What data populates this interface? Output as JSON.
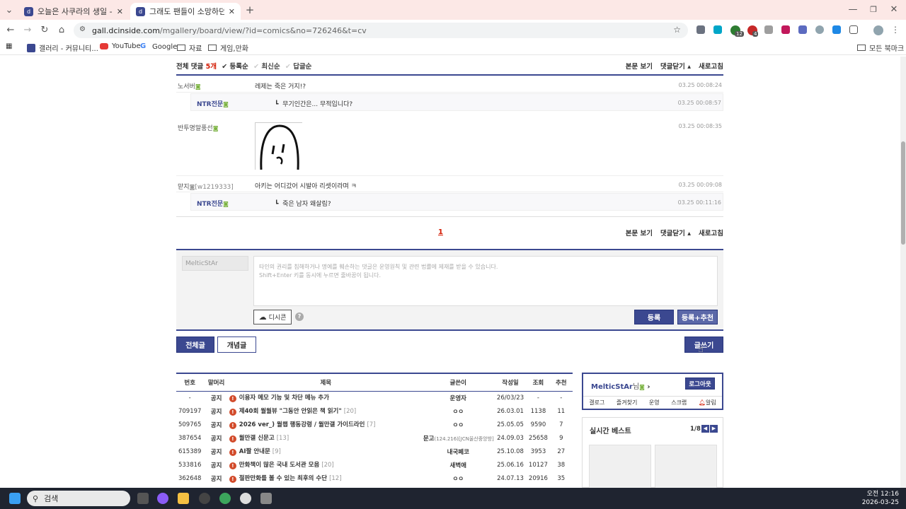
{
  "browser": {
    "tabs": [
      {
        "title": "오늘은 사쿠라의 생일 - 프리피"
      },
      {
        "title": "그래도 팬들이 소망하던거 마지"
      }
    ],
    "url_host": "gall.dcinside.com",
    "url_path": "/mgallery/board/view/?id=comics&no=726246&t=cv",
    "ext_badge1": "12",
    "ext_badge2": "4",
    "bookmarks": [
      "갤러리 - 커뮤니티...",
      "YouTube",
      "Google",
      "자료",
      "게임,만화"
    ],
    "all_bookmarks": "모든 북마크"
  },
  "comments_header": {
    "total_label": "전체 댓글",
    "count": "5개",
    "sort_reg": "등록순",
    "sort_new": "최신순",
    "sort_reply": "답글순",
    "view_post": "본문 보기",
    "close_comments": "댓글닫기",
    "refresh": "새로고침"
  },
  "comments": [
    {
      "nick": "노서버",
      "text": "레제는 죽은 거지!?",
      "date": "03.25 00:08:24"
    },
    {
      "nick": "NTR전문",
      "text": "무기인간은... 무적입니다?",
      "date": "03.25 00:08:57",
      "reply": true
    },
    {
      "nick": "반투명말풍선",
      "text": "",
      "date": "03.25 00:08:35",
      "image": true
    },
    {
      "nick": "맏지",
      "ip": "[w1219333]",
      "text": "아키는 어디갔어 시발아 리셋이라며 ㅋ",
      "date": "03.25 00:09:08"
    },
    {
      "nick": "NTR전문",
      "text": "죽은 남자 왜살림?",
      "date": "03.25 00:11:16",
      "reply": true
    }
  ],
  "pagination": {
    "current": "1"
  },
  "write": {
    "nick_placeholder": "MelticStAr",
    "placeholder": "타인의 권리를 침해하거나 명예를 훼손하는 댓글은 운영원칙 및 관련 법률에 제재를 받을 수 있습니다.\nShift+Enter 키를 동시에 누르면 줄바꿈이 됩니다.",
    "dccon": "디시콘",
    "submit": "등록",
    "submit_rec": "등록+추천"
  },
  "board_buttons": {
    "all": "전체글",
    "concept": "개념글",
    "write": "글쓰기"
  },
  "table": {
    "headers": [
      "번호",
      "말머리",
      "제목",
      "글쓴이",
      "작성일",
      "조회",
      "추천"
    ],
    "rows": [
      {
        "no": "-",
        "head": "공지",
        "title": "이용자 메모 기능 및 차단 메뉴 추가",
        "cnt": "",
        "writer": "운영자",
        "date": "26/03/23",
        "views": "-",
        "rec": "-"
      },
      {
        "no": "709197",
        "head": "공지",
        "title": "제40회 월월뷰 \"그동안 안읽은 책 읽기\"",
        "cnt": "[20]",
        "writer": "ㅇㅇ",
        "date": "26.03.01",
        "views": "1138",
        "rec": "11"
      },
      {
        "no": "509765",
        "head": "공지",
        "title": "2026 ver_) 월챕 행동강령 / 월만갤 가이드라인",
        "cnt": "[7]",
        "writer": "ㅇㅇ",
        "date": "25.05.05",
        "views": "9590",
        "rec": "7"
      },
      {
        "no": "387654",
        "head": "공지",
        "title": "월만갤 신문고",
        "cnt": "[13]",
        "writer": "문고",
        "writer_extra": "(124.216)[JCN울산중앙방]",
        "date": "24.09.03",
        "views": "25658",
        "rec": "9"
      },
      {
        "no": "615389",
        "head": "공지",
        "title": "AI짤 안내문",
        "cnt": "[9]",
        "writer": "내국페코",
        "date": "25.10.08",
        "views": "3953",
        "rec": "27"
      },
      {
        "no": "533816",
        "head": "공지",
        "title": "만화책이 많은 국내 도서관 모음",
        "cnt": "[20]",
        "writer": "새벽애",
        "date": "25.06.16",
        "views": "10127",
        "rec": "38"
      },
      {
        "no": "362648",
        "head": "공지",
        "title": "절판만화를 볼 수 있는 최후의 수단",
        "cnt": "[12]",
        "writer": "ㅇㅇ",
        "date": "24.07.13",
        "views": "20916",
        "rec": "35"
      }
    ]
  },
  "user_box": {
    "name": "MelticStAr",
    "suffix": "님",
    "logout": "로그아웃",
    "menu": [
      "갤로그",
      "즐겨찾기",
      "운영",
      "스크랩",
      "알림"
    ]
  },
  "realtime": {
    "title": "실시간 베스트",
    "page": "1/8"
  },
  "taskbar": {
    "search": "검색",
    "time": "오전 12:16",
    "date": "2026-03-25"
  }
}
